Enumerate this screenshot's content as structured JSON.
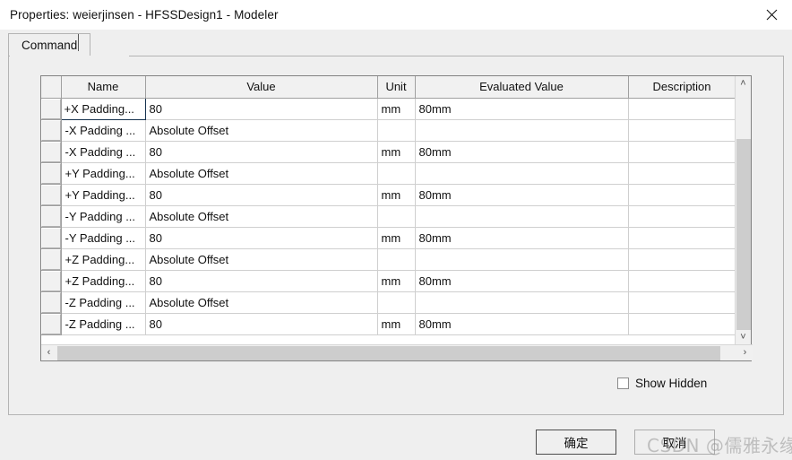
{
  "window": {
    "title": "Properties: weierjinsen - HFSSDesign1 - Modeler",
    "close_icon": "close-icon"
  },
  "tabs": [
    {
      "label": "Command",
      "active": true
    }
  ],
  "grid": {
    "columns": [
      "Name",
      "Value",
      "Unit",
      "Evaluated Value",
      "Description"
    ],
    "rows": [
      {
        "name": "+X Padding...",
        "value": "80",
        "unit": "mm",
        "evaluated": "80mm",
        "description": "",
        "selected": true
      },
      {
        "name": "-X Padding ...",
        "value": "Absolute Offset",
        "unit": "",
        "evaluated": "",
        "description": "",
        "selected": false
      },
      {
        "name": "-X Padding ...",
        "value": "80",
        "unit": "mm",
        "evaluated": "80mm",
        "description": "",
        "selected": false
      },
      {
        "name": "+Y Padding...",
        "value": "Absolute Offset",
        "unit": "",
        "evaluated": "",
        "description": "",
        "selected": false
      },
      {
        "name": "+Y Padding...",
        "value": "80",
        "unit": "mm",
        "evaluated": "80mm",
        "description": "",
        "selected": false
      },
      {
        "name": "-Y Padding ...",
        "value": "Absolute Offset",
        "unit": "",
        "evaluated": "",
        "description": "",
        "selected": false
      },
      {
        "name": "-Y Padding ...",
        "value": "80",
        "unit": "mm",
        "evaluated": "80mm",
        "description": "",
        "selected": false
      },
      {
        "name": "+Z Padding...",
        "value": "Absolute Offset",
        "unit": "",
        "evaluated": "",
        "description": "",
        "selected": false
      },
      {
        "name": "+Z Padding...",
        "value": "80",
        "unit": "mm",
        "evaluated": "80mm",
        "description": "",
        "selected": false
      },
      {
        "name": "-Z Padding ...",
        "value": "Absolute Offset",
        "unit": "",
        "evaluated": "",
        "description": "",
        "selected": false
      },
      {
        "name": "-Z Padding ...",
        "value": "80",
        "unit": "mm",
        "evaluated": "80mm",
        "description": "",
        "selected": false
      }
    ],
    "selection_color": "#0b7ad5",
    "scroll_up_glyph": "˄",
    "scroll_down_glyph": "˅",
    "scroll_left_glyph": "‹",
    "scroll_right_glyph": "›"
  },
  "options": {
    "show_hidden_label": "Show Hidden",
    "show_hidden_checked": false
  },
  "buttons": {
    "ok_label": "确定",
    "cancel_label": "取消"
  },
  "watermark": {
    "text": "CSDN @儒雅永缘"
  }
}
